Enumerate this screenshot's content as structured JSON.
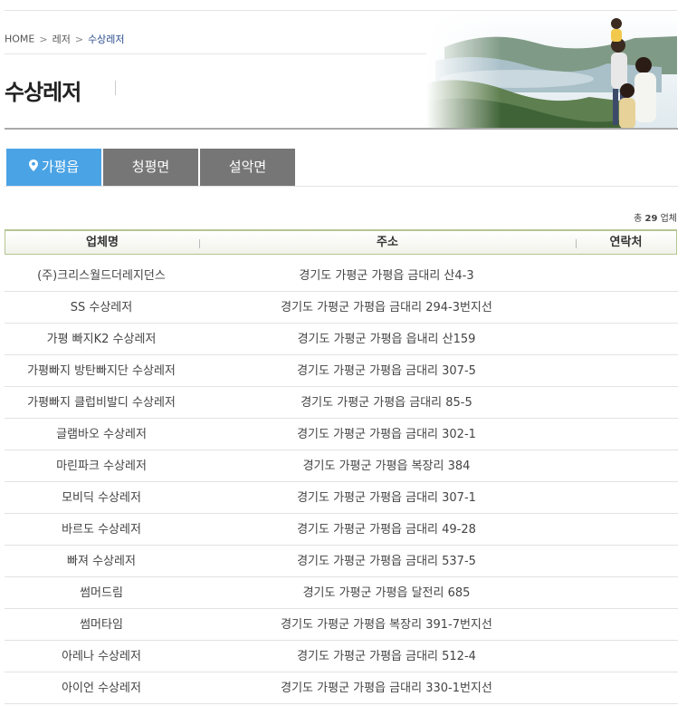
{
  "breadcrumb": {
    "home": "HOME",
    "level1": "레저",
    "current": "수상레저"
  },
  "page": {
    "title": "수상레저"
  },
  "tabs": [
    {
      "label": "가평읍",
      "active": true
    },
    {
      "label": "청평면",
      "active": false
    },
    {
      "label": "설악면",
      "active": false
    }
  ],
  "summary": {
    "prefix": "총",
    "count": "29",
    "suffix": "업체"
  },
  "table": {
    "headers": [
      "업체명",
      "주소",
      "연락처"
    ],
    "rows": [
      {
        "name": "(주)크리스월드더레지던스",
        "address": "경기도 가평군 가평읍 금대리 산4-3",
        "phone": ""
      },
      {
        "name": "SS 수상레저",
        "address": "경기도 가평군 가평읍 금대리 294-3번지선",
        "phone": ""
      },
      {
        "name": "가평 빠지K2 수상레저",
        "address": "경기도 가평군 가평읍 읍내리 산159",
        "phone": ""
      },
      {
        "name": "가평빠지 방탄빠지단 수상레저",
        "address": "경기도 가평군 가평읍 금대리 307-5",
        "phone": ""
      },
      {
        "name": "가평빠지 클럽비발디 수상레저",
        "address": "경기도 가평군 가평읍 금대리 85-5",
        "phone": ""
      },
      {
        "name": "글램바오 수상레저",
        "address": "경기도 가평군 가평읍 금대리 302-1",
        "phone": ""
      },
      {
        "name": "마린파크 수상레저",
        "address": "경기도 가평군 가평읍 복장리 384",
        "phone": ""
      },
      {
        "name": "모비딕 수상레저",
        "address": "경기도 가평군 가평읍 금대리 307-1",
        "phone": ""
      },
      {
        "name": "바르도 수상레저",
        "address": "경기도 가평군 가평읍 금대리 49-28",
        "phone": ""
      },
      {
        "name": "빠져 수상레저",
        "address": "경기도 가평군 가평읍 금대리 537-5",
        "phone": ""
      },
      {
        "name": "썸머드림",
        "address": "경기도 가평군 가평읍 달전리 685",
        "phone": ""
      },
      {
        "name": "썸머타임",
        "address": "경기도 가평군 가평읍 복장리 391-7번지선",
        "phone": ""
      },
      {
        "name": "아레나 수상레저",
        "address": "경기도 가평군 가평읍 금대리 512-4",
        "phone": ""
      },
      {
        "name": "아이언 수상레저",
        "address": "경기도 가평군 가평읍 금대리 330-1번지선",
        "phone": ""
      }
    ]
  },
  "colors": {
    "active_tab": "#4aa3e5",
    "inactive_tab": "#767676",
    "breadcrumb_current": "#2b4d8c",
    "header_border": "#b5c592"
  }
}
